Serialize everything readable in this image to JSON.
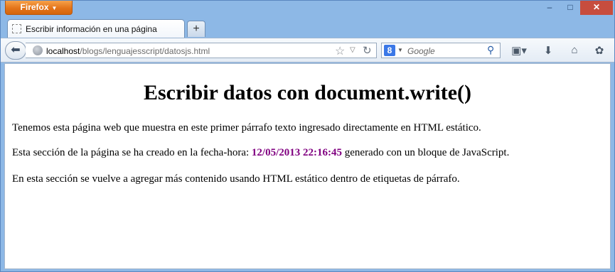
{
  "browser": {
    "menu_button": "Firefox",
    "window_controls": {
      "minimize": "–",
      "maximize": "□",
      "close": "✕"
    }
  },
  "tab": {
    "title": "Escribir información en una página",
    "new_tab_label": "+"
  },
  "navigation": {
    "url_host": "localhost",
    "url_path": "/blogs/lenguajesscript/datosjs.html",
    "search_placeholder": "Google",
    "search_engine_logo": "8"
  },
  "icons": [
    "back-arrow-icon",
    "globe-icon",
    "bookmark-star-icon",
    "reload-icon",
    "google-icon",
    "search-icon",
    "bookmarks-menu-icon",
    "download-icon",
    "home-icon",
    "addon-icon"
  ],
  "page": {
    "heading": "Escribir datos con document.write()",
    "paragraph1": "Tenemos esta página web que muestra en este primer párrafo texto ingresado directamente en HTML estático.",
    "paragraph2_before": "Esta sección de la página se ha creado en la fecha-hora: ",
    "datetime": "12/05/2013 22:16:45",
    "paragraph2_after": " generado con un bloque de JavaScript.",
    "paragraph3": "En esta sección se vuelve a agregar más contenido usando HTML estático dentro de etiquetas de párrafo."
  },
  "colors": {
    "datetime_text": "#800080",
    "firefox_button": "#e3741a",
    "close_button": "#c74d3e"
  }
}
